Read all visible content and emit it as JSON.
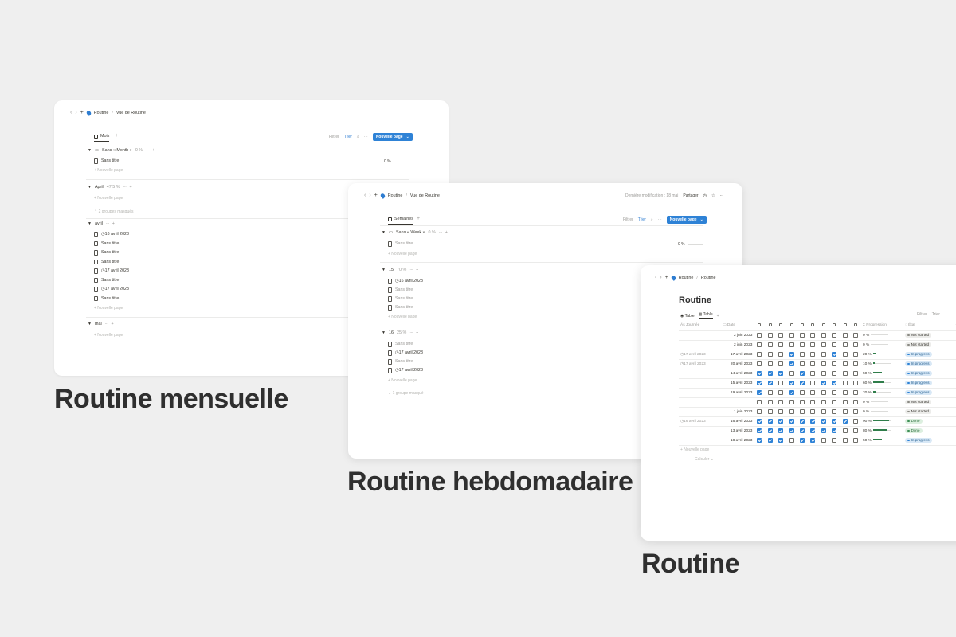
{
  "captions": {
    "monthly": "Routine mensuelle",
    "weekly": "Routine hebdomadaire",
    "routine": "Routine"
  },
  "monthly": {
    "crumb_root": "Routine",
    "crumb_sep": "/",
    "crumb_page": "Vue de Routine",
    "view_tab": "Mois",
    "filter": "Filtrer",
    "sort": "Trier",
    "new_page": "Nouvelle page",
    "groups": [
      {
        "name": "Sans « Month »",
        "pct": "0 %",
        "items": [
          "Sans titre"
        ],
        "add": "+ Nouvelle page",
        "progress": "0 %"
      },
      {
        "name": "April",
        "pct": "47,5 %",
        "items": [],
        "add": "+ Nouvelle page",
        "hidden": "2 groupes masqués"
      },
      {
        "name": "avril",
        "pct": "",
        "items": [
          "◷16 avril 2023",
          "Sans titre",
          "Sans titre",
          "Sans titre",
          "◷17 avril 2023",
          "Sans titre",
          "◷17 avril 2023",
          "Sans titre"
        ],
        "add": "+ Nouvelle page"
      },
      {
        "name": "mai",
        "pct": "",
        "items": [],
        "add": "+ Nouvelle page"
      }
    ]
  },
  "weekly": {
    "crumb_root": "Routine",
    "crumb_sep": "/",
    "crumb_page": "Vue de Routine",
    "modified": "Dernière modification : 18 mai",
    "share": "Partager",
    "view_tab": "Semaines",
    "filter": "Filtrer",
    "sort": "Trier",
    "new_page": "Nouvelle page",
    "groups": [
      {
        "name": "Sans « Week »",
        "pct": "0 %",
        "items": [
          "Sans titre"
        ],
        "add": "+ Nouvelle page",
        "progress": "0 %"
      },
      {
        "name": "15",
        "pct": "70 %",
        "items": [
          "◷16 avril 2023",
          "Sans titre",
          "Sans titre",
          "Sans titre"
        ],
        "add": "+ Nouvelle page"
      },
      {
        "name": "16",
        "pct": "25 %",
        "items": [
          "Sans titre",
          "◷17 avril 2023",
          "Sans titre",
          "◷17 avril 2023"
        ],
        "add": "+ Nouvelle page",
        "hidden": "1 groupe masqué"
      }
    ]
  },
  "routine": {
    "crumb_root": "Routine",
    "crumb_sep": "/",
    "crumb_page": "Routine",
    "title": "Routine",
    "tabs": [
      "Table",
      "Table"
    ],
    "filter": "Filtrer",
    "sort": "Trier",
    "headers": {
      "journee": "Ás Journée",
      "date": "Date",
      "progression": "Progression",
      "etat": "État"
    },
    "checkbox_columns": 10,
    "rows": [
      {
        "journee": "",
        "date": "2 juin 2023",
        "checks": [
          0,
          0,
          0,
          0,
          0,
          0,
          0,
          0,
          0,
          0
        ],
        "progress": "0 %",
        "fill": 0,
        "status": "Not started",
        "kind": "ns"
      },
      {
        "journee": "",
        "date": "2 juin 2023",
        "checks": [
          0,
          0,
          0,
          0,
          0,
          0,
          0,
          0,
          0,
          0
        ],
        "progress": "0 %",
        "fill": 0,
        "status": "Not started",
        "kind": "ns"
      },
      {
        "journee": "◷17 avril 2023",
        "date": "17 avril 2023",
        "checks": [
          0,
          0,
          0,
          1,
          0,
          0,
          0,
          1,
          0,
          0
        ],
        "progress": "20 %",
        "fill": 0.2,
        "status": "In progress",
        "kind": "ip"
      },
      {
        "journee": "◷17 avril 2023",
        "date": "20 avril 2023",
        "checks": [
          0,
          0,
          0,
          1,
          0,
          0,
          0,
          0,
          0,
          0
        ],
        "progress": "10 %",
        "fill": 0.1,
        "status": "In progress",
        "kind": "ip"
      },
      {
        "journee": "",
        "date": "14 avril 2023",
        "checks": [
          1,
          1,
          1,
          0,
          1,
          0,
          0,
          0,
          0,
          0
        ],
        "progress": "50 %",
        "fill": 0.5,
        "status": "In progress",
        "kind": "ip"
      },
      {
        "journee": "",
        "date": "15 avril 2023",
        "checks": [
          1,
          1,
          0,
          1,
          1,
          0,
          1,
          1,
          0,
          0
        ],
        "progress": "60 %",
        "fill": 0.6,
        "status": "In progress",
        "kind": "ip"
      },
      {
        "journee": "",
        "date": "19 avril 2023",
        "checks": [
          1,
          0,
          0,
          1,
          0,
          0,
          0,
          0,
          0,
          0
        ],
        "progress": "20 %",
        "fill": 0.2,
        "status": "In progress",
        "kind": "ip"
      },
      {
        "journee": "",
        "date": "",
        "checks": [
          0,
          0,
          0,
          0,
          0,
          0,
          0,
          0,
          0,
          0
        ],
        "progress": "0 %",
        "fill": 0,
        "status": "Not started",
        "kind": "ns"
      },
      {
        "journee": "",
        "date": "1 juin 2023",
        "checks": [
          0,
          0,
          0,
          0,
          0,
          0,
          0,
          0,
          0,
          0
        ],
        "progress": "0 %",
        "fill": 0,
        "status": "Not started",
        "kind": "ns"
      },
      {
        "journee": "◷16 avril 2023",
        "date": "16 avril 2023",
        "checks": [
          1,
          1,
          1,
          1,
          1,
          1,
          1,
          1,
          1,
          0
        ],
        "progress": "90 %",
        "fill": 0.9,
        "status": "Done",
        "kind": "dn"
      },
      {
        "journee": "",
        "date": "13 avril 2023",
        "checks": [
          1,
          1,
          1,
          1,
          1,
          1,
          1,
          1,
          0,
          0
        ],
        "progress": "80 %",
        "fill": 0.8,
        "status": "Done",
        "kind": "dn"
      },
      {
        "journee": "",
        "date": "18 avril 2023",
        "checks": [
          1,
          1,
          1,
          0,
          1,
          1,
          0,
          0,
          0,
          0
        ],
        "progress": "50 %",
        "fill": 0.5,
        "status": "In progress",
        "kind": "ip"
      }
    ],
    "add": "+ Nouvelle page",
    "calc": "Calculer ⌄"
  }
}
